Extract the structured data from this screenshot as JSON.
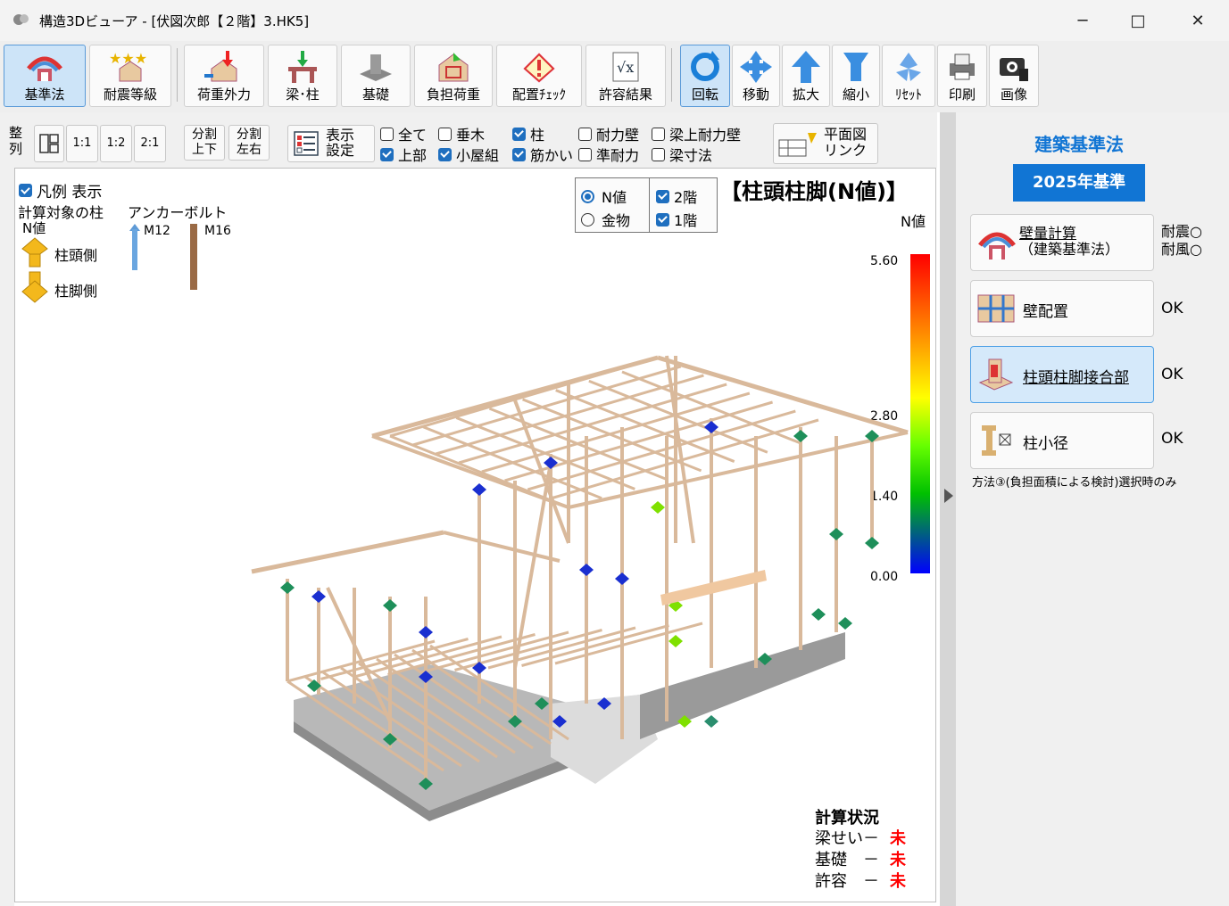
{
  "window": {
    "title": "構造3Dビューア - [伏図次郎【２階】3.HK5]",
    "controls": [
      "─",
      "□",
      "✕"
    ]
  },
  "toolbar": {
    "kijunho": "基準法",
    "taishin": "耐震等級",
    "kaju": "荷重外力",
    "hari": "梁･柱",
    "kiso": "基礎",
    "futan": "負担荷重",
    "haichi": "配置ﾁｪｯｸ",
    "kyoyo": "許容結果",
    "kaiten": "回転",
    "ido": "移動",
    "kakudai": "拡大",
    "shukusho": "縮小",
    "reset": "ﾘｾｯﾄ",
    "insatsu": "印刷",
    "gazo": "画像"
  },
  "options": {
    "seiretsu": "整列",
    "r11": "1:1",
    "r12": "1:2",
    "r21": "2:1",
    "split_ud": [
      "分割",
      "上下"
    ],
    "split_lr": [
      "分割",
      "左右"
    ],
    "display": [
      "表示",
      "設定"
    ],
    "checks": [
      {
        "label": "全て",
        "checked": false
      },
      {
        "label": "上部",
        "checked": true
      },
      {
        "label": "垂木",
        "checked": false
      },
      {
        "label": "小屋組",
        "checked": true
      },
      {
        "label": "柱",
        "checked": true
      },
      {
        "label": "筋かい",
        "checked": true
      },
      {
        "label": "耐力壁",
        "checked": false
      },
      {
        "label": "準耐力",
        "checked": false
      },
      {
        "label": "梁上耐力壁",
        "checked": false
      },
      {
        "label": "梁寸法",
        "checked": false
      }
    ],
    "plan_link": [
      "平面図",
      "リンク"
    ]
  },
  "view": {
    "legend_toggle": "凡例 表示",
    "legend_title": "計算対象の柱",
    "legend_nval": "N値",
    "top_side": "柱頭側",
    "bottom_side": "柱脚側",
    "anchor_title": "アンカーボルト",
    "m12": "M12",
    "m16": "M16",
    "radio_n": "N値",
    "radio_kanamono": "金物",
    "floor2": "2階",
    "floor1": "1階",
    "heading": "【柱頭柱脚(N値)】",
    "scale_title": "N値",
    "scale_ticks": [
      "5.60",
      "2.80",
      "1.40",
      "0.00"
    ],
    "calc_title": "計算状況",
    "calc_rows": [
      {
        "label": "梁せい－",
        "status": "未"
      },
      {
        "label": "基礎　－",
        "status": "未"
      },
      {
        "label": "許容　－",
        "status": "未"
      }
    ]
  },
  "side": {
    "header": "建築基準法",
    "standard": "2025年基準",
    "wall_calc": [
      "壁量計算",
      "（建築基準法）"
    ],
    "wall_status": [
      "耐震○",
      "耐風○"
    ],
    "wall_layout": "壁配置",
    "wall_layout_status": "OK",
    "joint": "柱頭柱脚接合部",
    "joint_status": "OK",
    "column_dia": "柱小径",
    "column_dia_status": "OK",
    "note": "方法③(負担面積による検討)選択時のみ"
  },
  "colors": {
    "accent_blue": "#1175d4",
    "status_red": "#ff0000",
    "timber": "#d9b99b"
  }
}
